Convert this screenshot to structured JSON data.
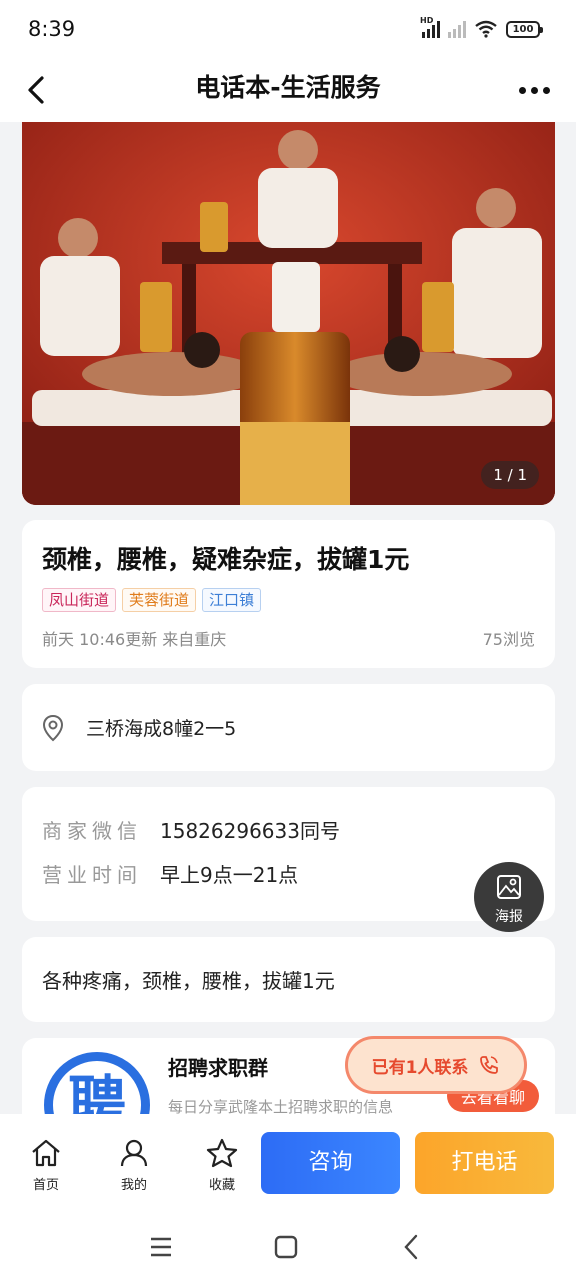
{
  "status_bar": {
    "time": "8:39",
    "battery": "100"
  },
  "nav": {
    "title": "电话本-生活服务"
  },
  "gallery": {
    "counter": "1 / 1"
  },
  "post": {
    "title": "颈椎，腰椎，疑难杂症，拔罐1元",
    "tags": [
      "凤山街道",
      "芙蓉街道",
      "江口镇"
    ],
    "meta": "前天 10:46更新 来自重庆",
    "views": "75浏览"
  },
  "address": {
    "text": "三桥海成8幢2一5"
  },
  "info": {
    "wechat_label": "商家微信",
    "wechat_value": "15826296633同号",
    "hours_label": "营业时间",
    "hours_value": "早上9点一21点"
  },
  "description": {
    "text": "各种疼痛，颈椎，腰椎，拔罐1元"
  },
  "ad": {
    "logo_char": "聘",
    "title": "招聘求职群",
    "subtitle": "每日分享武隆本土招聘求职的信息",
    "chat_label": "去看看聊"
  },
  "floating": {
    "poster_label": "海报",
    "contact_label": "已有1人联系"
  },
  "bottom_bar": {
    "home_label": "首页",
    "me_label": "我的",
    "favorite_label": "收藏",
    "consult_label": "咨询",
    "call_label": "打电话"
  }
}
